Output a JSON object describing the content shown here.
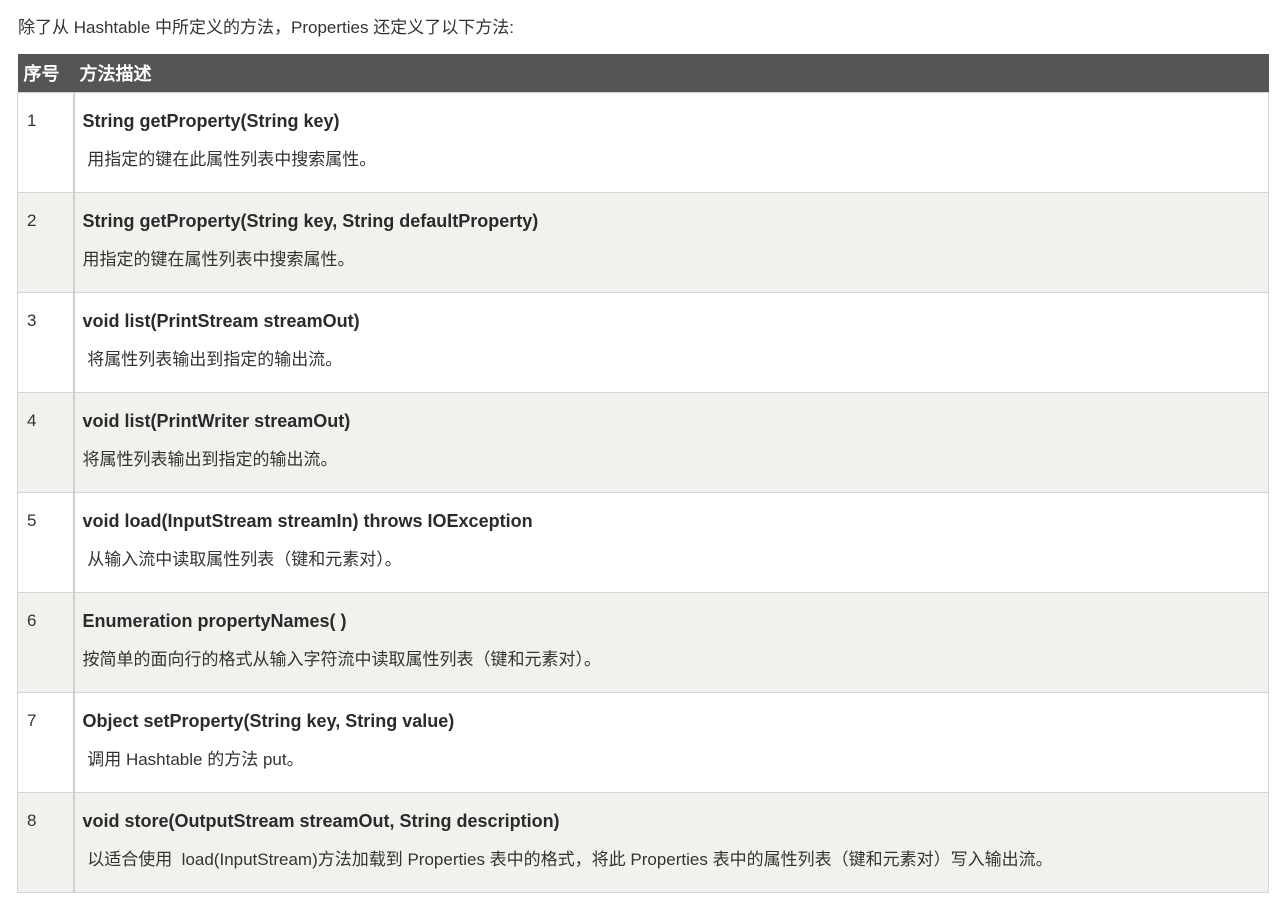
{
  "intro": "除了从 Hashtable 中所定义的方法，Properties 还定义了以下方法:",
  "table": {
    "headers": [
      "序号",
      "方法描述"
    ],
    "rows": [
      {
        "num": "1",
        "signature": "String getProperty(String key)",
        "description": " 用指定的键在此属性列表中搜索属性。"
      },
      {
        "num": "2",
        "signature": "String getProperty(String key, String defaultProperty)",
        "description": "用指定的键在属性列表中搜索属性。"
      },
      {
        "num": "3",
        "signature": "void list(PrintStream streamOut)",
        "description": " 将属性列表输出到指定的输出流。"
      },
      {
        "num": "4",
        "signature": "void list(PrintWriter streamOut)",
        "description": "将属性列表输出到指定的输出流。"
      },
      {
        "num": "5",
        "signature": "void load(InputStream streamIn) throws IOException",
        "description": " 从输入流中读取属性列表（键和元素对）。"
      },
      {
        "num": "6",
        "signature": "Enumeration propertyNames( )",
        "description": "按简单的面向行的格式从输入字符流中读取属性列表（键和元素对）。"
      },
      {
        "num": "7",
        "signature": "Object setProperty(String key, String value)",
        "description": " 调用 Hashtable 的方法 put。"
      },
      {
        "num": "8",
        "signature": "void store(OutputStream streamOut, String description)",
        "description": " 以适合使用  load(InputStream)方法加载到 Properties 表中的格式，将此 Properties 表中的属性列表（键和元素对）写入输出流。"
      }
    ]
  }
}
